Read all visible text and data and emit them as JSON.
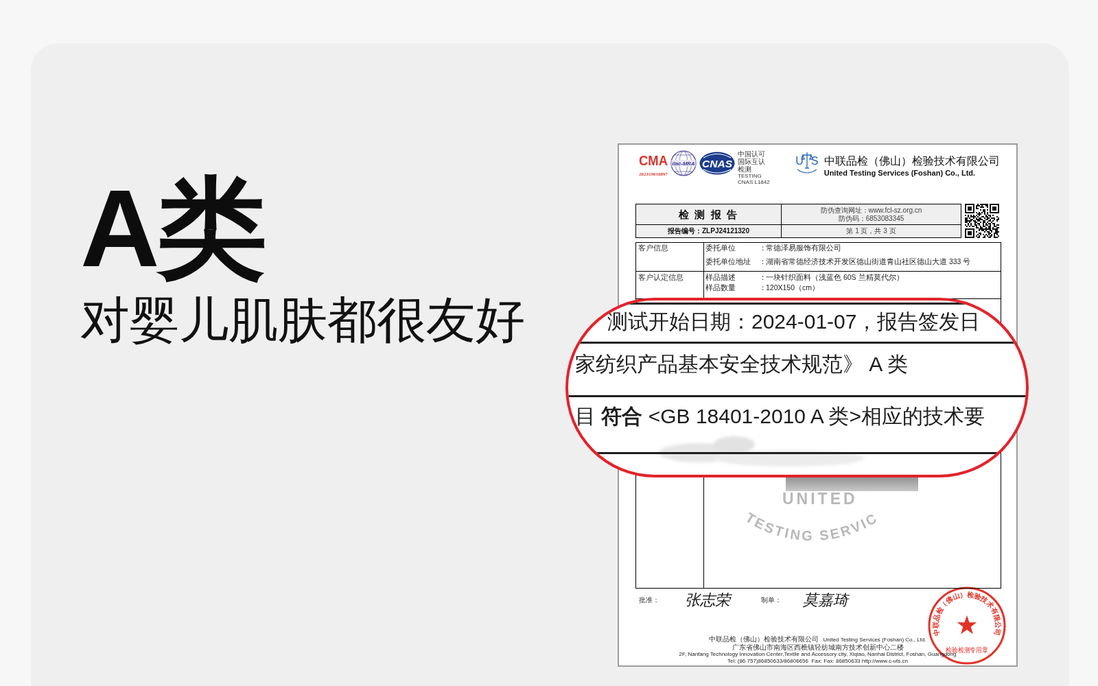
{
  "headline": {
    "title": "A类",
    "subtitle": "对婴儿肌肤都很友好"
  },
  "report": {
    "logos": {
      "cma": "CMA",
      "cma_number": "202319016897",
      "ilac": "ilac-MRA",
      "cnas": "CNAS",
      "accreditation_note": [
        {
          "text": "中国认可",
          "kind": "cn"
        },
        {
          "text": "国际互认",
          "kind": "cn"
        },
        {
          "text": "检测",
          "kind": "cn"
        },
        {
          "text": "TESTING",
          "kind": "en"
        },
        {
          "text": "CNAS L1842",
          "kind": "en"
        }
      ],
      "uts_letters": [
        "U",
        "S"
      ]
    },
    "company": {
      "name_cn": "中联品检（佛山）检验技术有限公司",
      "name_en": "United Testing Services (Foshan) Co., Ltd."
    },
    "header": {
      "title": "检 测 报 告",
      "report_number": "报告编号：ZLPJ24121320",
      "verify_url": "防伪查询网址：www.fcl-sz.org.cn",
      "verify_code": "防伪码：6853083345",
      "page": "第 1 页，共 3 页"
    },
    "sections": [
      {
        "label": "客户信息",
        "fields": [
          {
            "label": "委托单位",
            "separator": "：",
            "value": "常德泽易服饰有限公司"
          },
          {
            "label": "委托单位地址",
            "separator": "：",
            "value": "湖南省常德经济技术开发区德山街道青山社区德山大道 333 号"
          }
        ]
      },
      {
        "label": "客户认定信息",
        "fields": [
          {
            "label": "样品描述",
            "separator": "：",
            "value": "一块针织面料（浅蓝色 60S 兰精莫代尔）"
          },
          {
            "label": "样品数量",
            "separator": "：",
            "value": "120X150（cm）"
          }
        ]
      }
    ],
    "watermark": {
      "center": "UNITED",
      "arc": "TESTING SERVIC"
    },
    "signatures": [
      {
        "label": "批准：",
        "name": "张志荣"
      },
      {
        "label": "制单：",
        "name": "莫嘉琦"
      }
    ],
    "footer": [
      [
        {
          "text": "中联品检（佛山）检验技术有限公司",
          "kind": "cn"
        },
        {
          "text": "United Testing Services (Foshan) Co., Ltd.",
          "kind": "en"
        }
      ],
      [
        {
          "text": "广东省佛山市南海区西樵镇轻纺城南方技术创新中心二楼",
          "kind": "cn"
        }
      ],
      [
        {
          "text": "2F, Nanfang Technology Innovation Center,Textile and Accessory city, Xiqiao, Nanhai District, Foshan, Guangdong",
          "kind": "en"
        }
      ],
      [
        {
          "text": "Tel: (86 757)86850633/86806656  Fax: Fax: 86850633 http://www.c-uts.cn",
          "kind": "en"
        }
      ]
    ],
    "seal": {
      "ring_text": "中联品检（佛山）检验技术有限公司",
      "bottom_text": "检验检测专用章"
    }
  },
  "magnifier": {
    "rows": [
      "测试开始日期：2024-01-07，报告签发日",
      "家纺织产品基本安全技术规范》 A 类",
      "目 **符合** <GB 18401-2010 A 类>相应的技术要"
    ]
  }
}
